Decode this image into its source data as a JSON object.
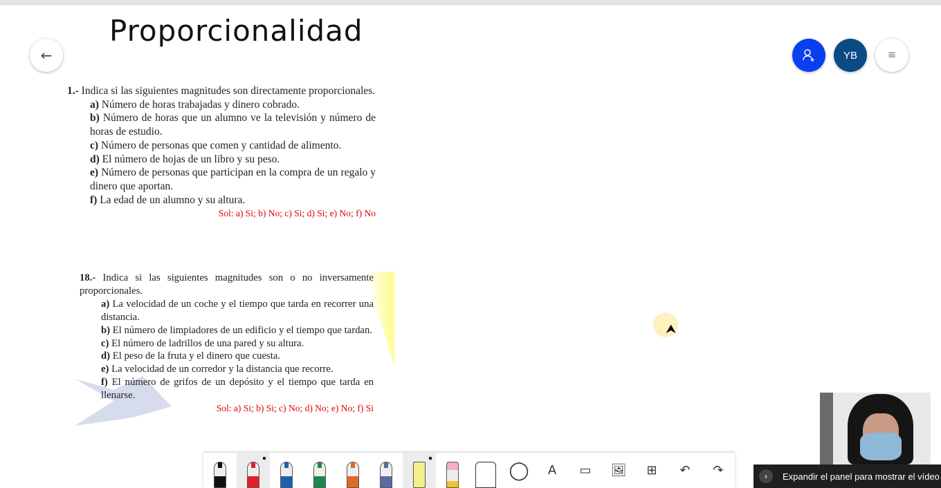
{
  "header": {
    "title": "Proporcionalidad",
    "avatar_initials": "YB"
  },
  "ex1": {
    "number": "1.-",
    "statement": "Indica si las siguientes magnitudes son directamente proporcionales.",
    "items": [
      {
        "k": "a)",
        "t": "Número de horas trabajadas y dinero cobrado."
      },
      {
        "k": "b)",
        "t": "Número de horas que un alumno ve la televisión y número de horas de estudio."
      },
      {
        "k": "c)",
        "t": "Número de personas que comen y cantidad de alimento."
      },
      {
        "k": "d)",
        "t": "El número de hojas de un libro y su peso."
      },
      {
        "k": "e)",
        "t": "Número de personas que participan en la compra de un regalo y dinero que aportan."
      },
      {
        "k": "f)",
        "t": "La edad de un alumno y su altura."
      }
    ],
    "solution": "Sol: a) Si; b) No; c) Si; d) Si; e) No; f) No"
  },
  "ex18": {
    "number": "18.-",
    "statement": "Indica si las siguientes magnitudes son o no inversamente proporcionales.",
    "items": [
      {
        "k": "a)",
        "t": "La velocidad de un coche y el tiempo que tarda en recorrer una distancia."
      },
      {
        "k": "b)",
        "t": "El número de limpiadores de un edificio y el tiempo que tardan."
      },
      {
        "k": "c)",
        "t": "El número de ladrillos de una pared y su altura."
      },
      {
        "k": "d)",
        "t": "El peso de la fruta y el dinero que cuesta."
      },
      {
        "k": "e)",
        "t": "La velocidad de un corredor y la distancia que recorre."
      },
      {
        "k": "f)",
        "t": "El número de grifos de un depósito y el tiempo que tarda en llenarse."
      }
    ],
    "solution": "Sol: a) Si; b) Si; c) No; d) No; e) No; f) Si"
  },
  "toolbar": {
    "pens": [
      {
        "name": "black",
        "color": "#111111"
      },
      {
        "name": "red",
        "color": "#e0202a"
      },
      {
        "name": "blue",
        "color": "#1f5fb0"
      },
      {
        "name": "green",
        "color": "#1a8a4a"
      },
      {
        "name": "rainbow",
        "color": "#e06a20"
      },
      {
        "name": "galaxy",
        "color": "#5a6aa0"
      }
    ],
    "highlighter_color": "#f5f08a",
    "text_tool": "A"
  },
  "panel": {
    "label": "Expandir el panel para mostrar el vídeo"
  }
}
